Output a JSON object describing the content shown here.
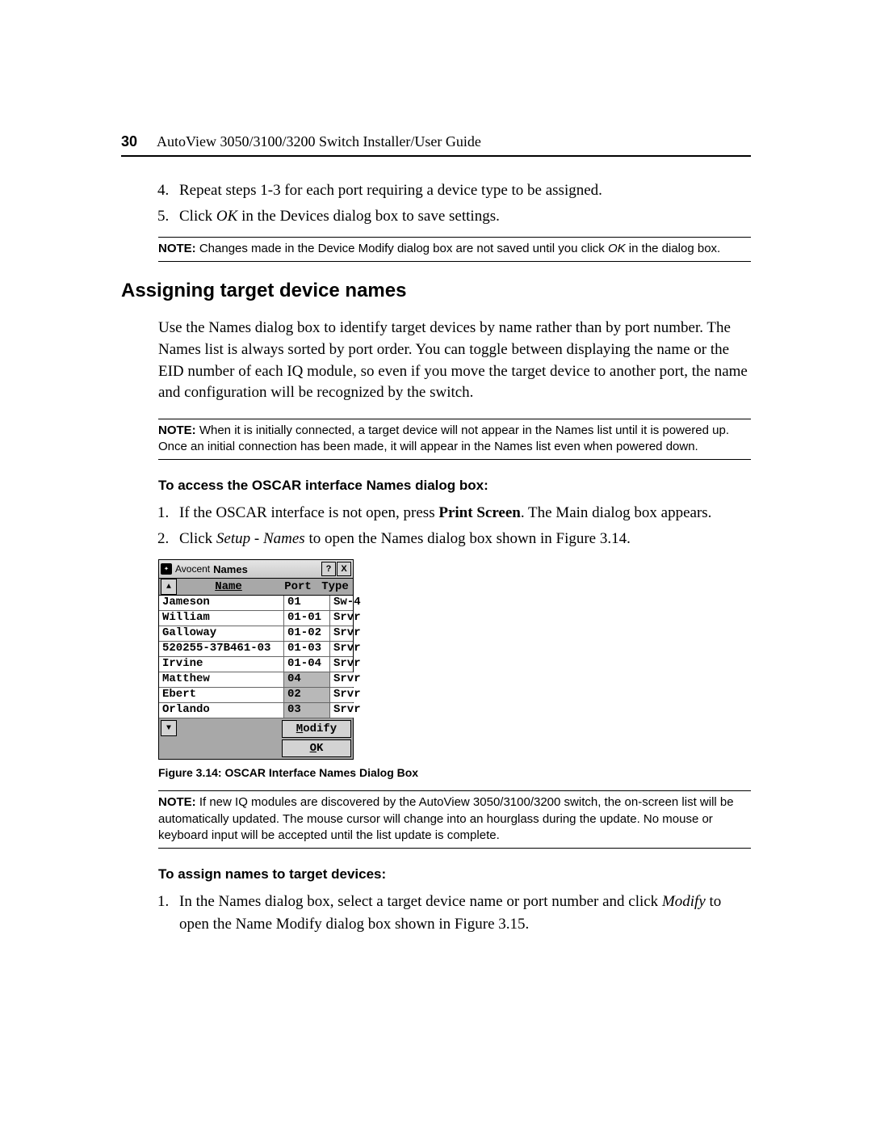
{
  "header": {
    "page_number": "30",
    "guide_title": "AutoView 3050/3100/3200 Switch Installer/User Guide"
  },
  "steps_top": {
    "start": 4,
    "items": [
      "Repeat steps 1-3 for each port requiring a device type to be assigned.",
      "Click OK in the Devices dialog box to save settings."
    ],
    "item5_prefix": "Click ",
    "item5_em": "OK",
    "item5_suffix": " in the Devices dialog box to save settings."
  },
  "note1": {
    "label": "NOTE:",
    "text_before": " Changes made in the Device Modify dialog box are not saved until you click ",
    "em": "OK",
    "text_after": " in the dialog box."
  },
  "section": {
    "title": "Assigning target device names",
    "paragraph": "Use the Names dialog box to identify target devices by name rather than by port number. The Names list is always sorted by port order. You can toggle between displaying the name or the EID number of each IQ module, so even if you move the target device to another port, the name and configuration will be recognized by the switch."
  },
  "note2": {
    "label": "NOTE:",
    "text": " When it is initially connected, a target device will not appear in the Names list until it is powered up. Once an initial connection has been made, it will appear in the Names list even when powered down."
  },
  "access": {
    "heading": "To access the OSCAR interface Names dialog box:",
    "step1": "If the OSCAR interface is not open, press Print Screen. The Main dialog box appears.",
    "step1_prefix": "If the OSCAR interface is not open, press ",
    "step1_bold": "Print Screen",
    "step1_suffix": ". The Main dialog box appears.",
    "step2_prefix": "Click ",
    "step2_em": "Setup - Names",
    "step2_suffix": " to open the Names dialog box shown in Figure 3.14."
  },
  "dialog": {
    "brand": "Avocent",
    "title": "Names",
    "help_label": "?",
    "close_label": "X",
    "sort_up": "⬆",
    "sort_dn": "⬇",
    "col_name": "Name",
    "col_port": "Port",
    "col_type": "Type",
    "rows": [
      {
        "name": "Jameson",
        "port": "01",
        "type": "Sw-4",
        "hl": false
      },
      {
        "name": "William",
        "port": "01-01",
        "type": "Srvr",
        "hl": false
      },
      {
        "name": "Galloway",
        "port": "01-02",
        "type": "Srvr",
        "hl": false
      },
      {
        "name": "520255-37B461-03",
        "port": "01-03",
        "type": "Srvr",
        "hl": false
      },
      {
        "name": "Irvine",
        "port": "01-04",
        "type": "Srvr",
        "hl": false
      },
      {
        "name": "Matthew",
        "port": "04",
        "type": "Srvr",
        "hl": true
      },
      {
        "name": "Ebert",
        "port": "02",
        "type": "Srvr",
        "hl": true
      },
      {
        "name": "Orlando",
        "port": "03",
        "type": "Srvr",
        "hl": true
      }
    ],
    "modify_btn": "Modify",
    "ok_btn": "OK"
  },
  "figure_caption": "Figure 3.14: OSCAR Interface Names Dialog Box",
  "note3": {
    "label": "NOTE:",
    "text": " If new IQ modules are discovered by the AutoView 3050/3100/3200 switch, the on-screen list will be automatically updated. The mouse cursor will change into an hourglass during the update. No mouse or keyboard input will be accepted until the list update is complete."
  },
  "assign": {
    "heading": "To assign names to target devices:",
    "step1_prefix": "In the Names dialog box, select a target device name or port number and click ",
    "step1_em": "Modify",
    "step1_suffix": " to open the Name Modify dialog box shown in Figure 3.15."
  }
}
